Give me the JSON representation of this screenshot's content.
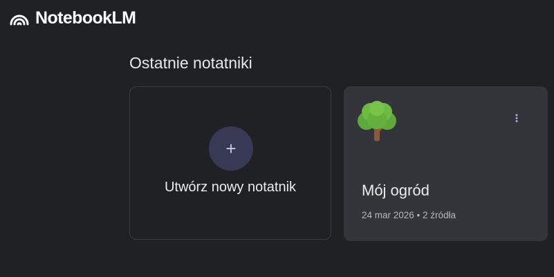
{
  "header": {
    "app_title": "NotebookLM",
    "logo_icon": "notebooklm-logo-icon"
  },
  "recent": {
    "section_title": "Ostatnie notatniki"
  },
  "create_card": {
    "icon": "plus-icon",
    "plus_glyph": "+",
    "label": "Utwórz nowy notatnik"
  },
  "notebooks": [
    {
      "emoji": "🌳",
      "icon": "tree-icon",
      "title": "Mój ogród",
      "meta": "24 mar 2026 • 2 źródła",
      "menu_icon": "more-vert-icon"
    }
  ],
  "colors": {
    "background": "#1f2125",
    "card": "#33353b",
    "create_card_border": "#3c3e43",
    "plus_circle": "#383a55",
    "menu_dots": "#9ab7e8"
  }
}
